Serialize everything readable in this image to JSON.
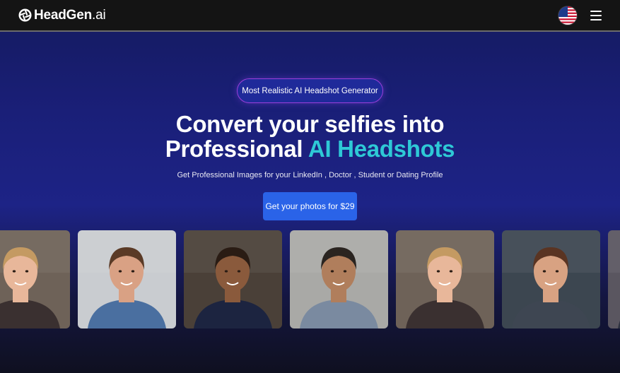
{
  "brand": {
    "name": "HeadGen",
    "suffix": ".ai",
    "icon": "aperture-logo-icon"
  },
  "nav": {
    "language_icon": "us-flag-icon",
    "menu_icon": "hamburger-menu-icon"
  },
  "hero": {
    "badge": "Most Realistic AI Headshot Generator",
    "headline_line1": "Convert your selfies into",
    "headline_line2_plain": "Professional ",
    "headline_line2_accent": "AI Headshots",
    "subheadline": "Get Professional Images for your LinkedIn , Doctor , Student or Dating Profile",
    "cta_label": "Get your photos for $29"
  },
  "colors": {
    "accent": "#2ec9d6",
    "cta": "#2a63e8",
    "badge_border": "#9b3fd9"
  },
  "gallery": [
    {
      "name": "headshot-woman-blonde",
      "bg": "#6e6258",
      "skin": "#e8b79a",
      "hair": "#c49a62",
      "shirt": "#3a3030"
    },
    {
      "name": "headshot-man-denim",
      "bg": "#c9ccd0",
      "skin": "#d9a184",
      "hair": "#5a3a26",
      "shirt": "#4a6fa0"
    },
    {
      "name": "headshot-woman-curly",
      "bg": "#4a4038",
      "skin": "#8a5a3c",
      "hair": "#2a1c14",
      "shirt": "#1c2440"
    },
    {
      "name": "headshot-man-suit",
      "bg": "#a9a9a6",
      "skin": "#b07e5c",
      "hair": "#2a2420",
      "shirt": "#7a8aa0"
    },
    {
      "name": "headshot-woman-blonde-2",
      "bg": "#6e6258",
      "skin": "#e8b79a",
      "hair": "#c49a62",
      "shirt": "#3a3030"
    },
    {
      "name": "headshot-man-blazer",
      "bg": "#3c4650",
      "skin": "#d8a282",
      "hair": "#5a3422",
      "shirt": "#3e4652"
    },
    {
      "name": "headshot-partial",
      "bg": "#5a5660",
      "skin": "#c89070",
      "hair": "#3a2a20",
      "shirt": "#2e3240"
    }
  ]
}
